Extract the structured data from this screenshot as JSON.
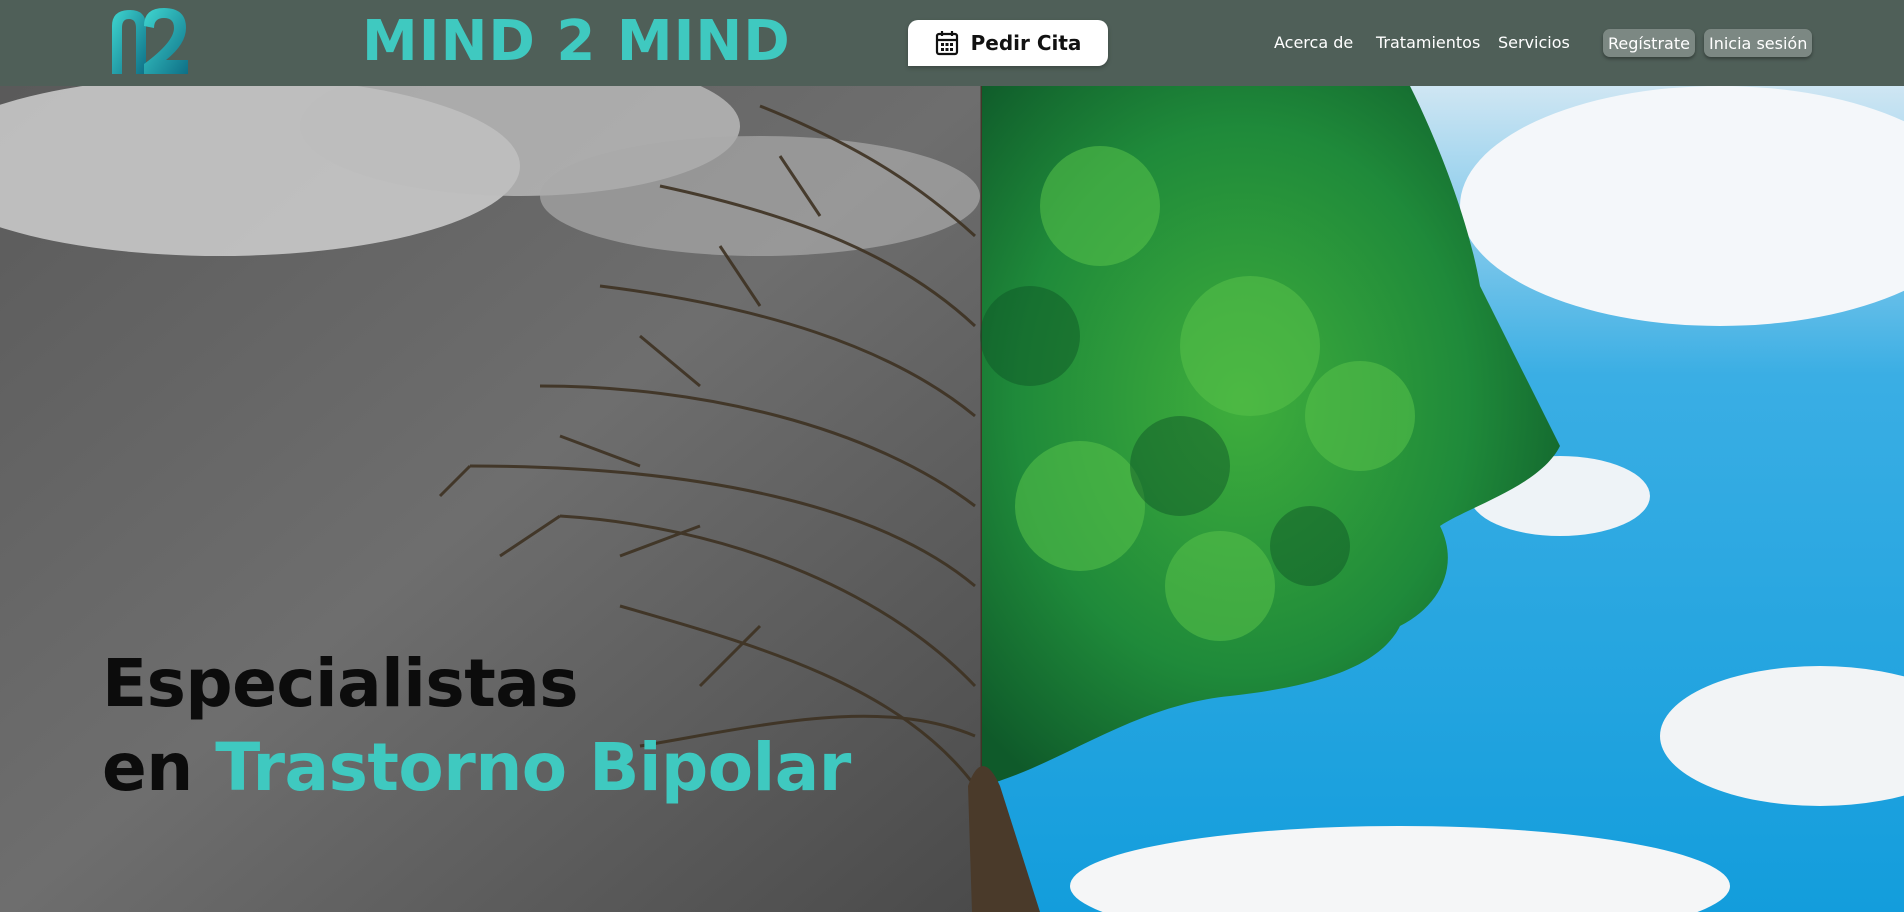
{
  "header": {
    "brand": "MIND 2 MIND",
    "cta_label": "Pedir Cita",
    "cta_icon": "calendar-icon",
    "nav": [
      "Acerca de",
      "Tratamientos",
      "Servicios"
    ],
    "register_label": "Regístrate",
    "login_label": "Inicia sesión"
  },
  "hero": {
    "line1": "Especialistas",
    "line2_prefix": "en",
    "line2_accent": "Trastorno Bipolar"
  },
  "colors": {
    "header_bg": "#4f5f58",
    "accent": "#3fc9c0",
    "sky": "#1aa3e0",
    "leaves": "#1f8a3a"
  }
}
